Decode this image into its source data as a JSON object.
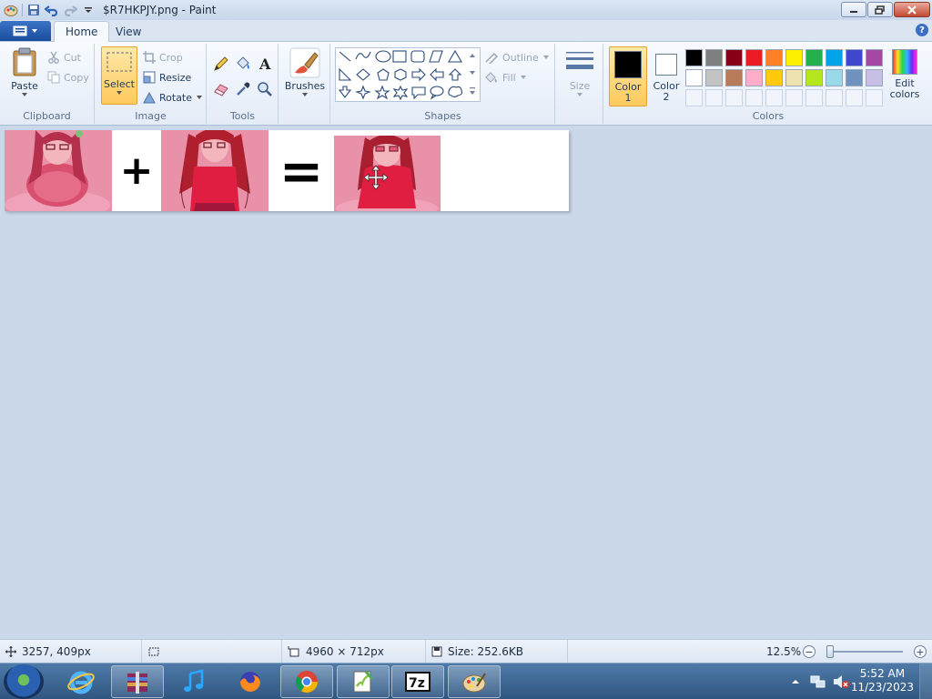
{
  "window": {
    "title": "$R7HKPJY.png - Paint"
  },
  "tabs": [
    {
      "label": "Home",
      "active": true
    },
    {
      "label": "View",
      "active": false
    }
  ],
  "ribbon": {
    "clipboard": {
      "label": "Clipboard",
      "paste": "Paste",
      "cut": "Cut",
      "copy": "Copy"
    },
    "image": {
      "label": "Image",
      "select": "Select",
      "crop": "Crop",
      "resize": "Resize",
      "rotate": "Rotate"
    },
    "tools": {
      "label": "Tools"
    },
    "brushes": {
      "label": "Brushes"
    },
    "shapes": {
      "label": "Shapes",
      "outline": "Outline",
      "fill": "Fill"
    },
    "size": {
      "label": "Size"
    },
    "colors": {
      "label": "Colors",
      "color1": "Color",
      "color1_num": "1",
      "color2": "Color",
      "color2_num": "2",
      "edit": "Edit",
      "edit2": "colors",
      "color1_value": "#000000",
      "color2_value": "#ffffff",
      "palette_row1": [
        "#000000",
        "#7f7f7f",
        "#880015",
        "#ed1c24",
        "#ff7f27",
        "#fff200",
        "#22b14c",
        "#00a2e8",
        "#3f48cc",
        "#a349a4"
      ],
      "palette_row2": [
        "#ffffff",
        "#c3c3c3",
        "#b97a57",
        "#ffaec9",
        "#ffc90e",
        "#efe4b0",
        "#b5e61d",
        "#99d9ea",
        "#7092be",
        "#c8bfe7"
      ]
    }
  },
  "canvas": {
    "plus": "+",
    "equals": "="
  },
  "status": {
    "cursor": "3257, 409px",
    "dimensions": "4960 × 712px",
    "size": "Size: 252.6KB",
    "zoom": "12.5%",
    "zoom_level": 0.125
  },
  "taskbar": {
    "time": "5:52 AM",
    "date": "11/23/2023"
  }
}
